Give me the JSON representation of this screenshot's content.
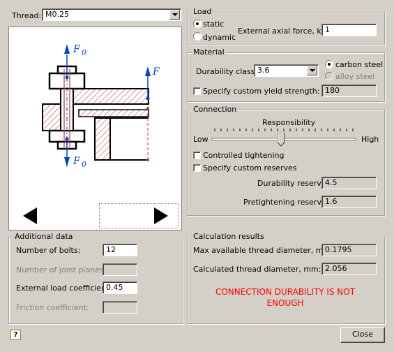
{
  "thread": {
    "label": "Thread:",
    "value": "M0.25"
  },
  "diagram": {
    "labels": {
      "f0_top": "F",
      "f0_top_sub": "0",
      "f_right": "F",
      "f0_bottom": "F",
      "f0_bottom_sub": "0"
    }
  },
  "load": {
    "title": "Load",
    "static": "static",
    "dynamic": "dynamic",
    "selected": "static",
    "axial_force_label": "External axial force, kN:",
    "axial_force_value": "1"
  },
  "material": {
    "title": "Material",
    "durability_label": "Durability class:",
    "durability_value": "3.6",
    "carbon_steel": "carbon steel",
    "alloy_steel": "alloy steel",
    "custom_yield_label": "Specify custom yield strength:",
    "custom_yield_value": "180"
  },
  "connection": {
    "title": "Connection",
    "responsibility_label": "Responsibility",
    "low": "Low",
    "high": "High",
    "slider_position": 0.48,
    "controlled_tightening": "Controlled tightening",
    "custom_reserves": "Specify custom reserves",
    "durability_reserve_label": "Durability reserve:",
    "durability_reserve_value": "4.5",
    "pretightening_reserve_label": "Pretightening reserve:",
    "pretightening_reserve_value": "1.6"
  },
  "additional": {
    "title": "Additional data",
    "bolts_label": "Number of bolts:",
    "bolts_value": "12",
    "joint_planes_label": "Number of joint planes:",
    "joint_planes_value": "",
    "load_coef_label": "External load coefficient:",
    "load_coef_value": "0.45",
    "friction_label": "Friction coefficient:",
    "friction_value": ""
  },
  "results": {
    "title": "Calculation results",
    "max_diameter_label": "Max available thread diameter, mm:",
    "max_diameter_value": "0.1795",
    "calc_diameter_label": "Calculated thread diameter, mm:",
    "calc_diameter_value": "2.056",
    "message_line1": "CONNECTION DURABILITY IS NOT",
    "message_line2": "ENOUGH",
    "message_color": "#ff0000"
  },
  "footer": {
    "help_icon": "?",
    "close": "Close"
  }
}
